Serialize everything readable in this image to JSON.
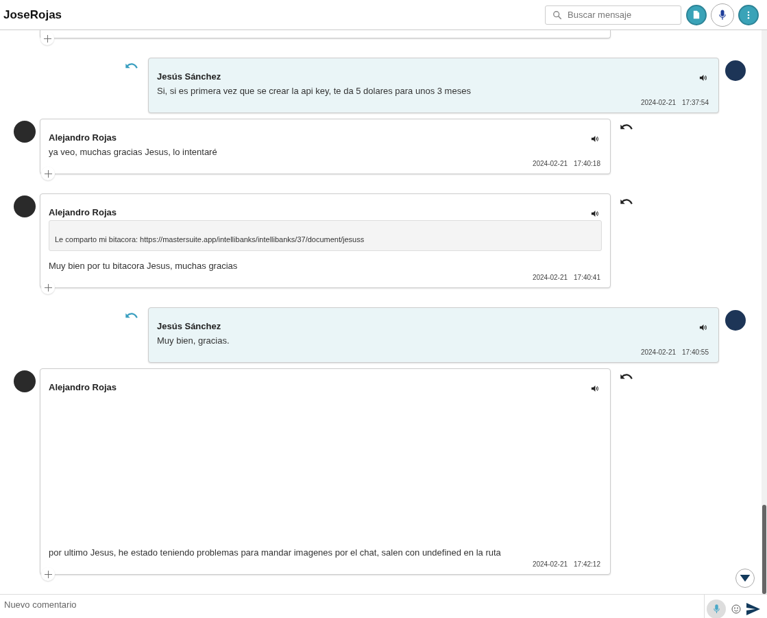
{
  "header": {
    "title": "JoseRojas",
    "search": {
      "placeholder": "Buscar mensaje"
    }
  },
  "messages": [
    {
      "kind": "outgoing",
      "sender": "Jesús Sánchez",
      "text": "Si, si es primera vez que se crear la api key, te da 5 dolares para unos 3 meses",
      "date": "2024-02-21",
      "time": "17:37:54"
    },
    {
      "kind": "incoming",
      "sender": "Alejandro Rojas",
      "text": "ya veo, muchas gracias Jesus, lo intentaré",
      "date": "2024-02-21",
      "time": "17:40:18"
    },
    {
      "kind": "incoming",
      "sender": "Alejandro Rojas",
      "quote": "Le comparto mi bitacora: https://mastersuite.app/intellibanks/intellibanks/37/document/jesuss",
      "text": "Muy bien por tu bitacora Jesus, muchas gracias",
      "date": "2024-02-21",
      "time": "17:40:41"
    },
    {
      "kind": "outgoing",
      "sender": "Jesús Sánchez",
      "text": "Muy bien, gracias.",
      "date": "2024-02-21",
      "time": "17:40:55"
    },
    {
      "kind": "incoming",
      "sender": "Alejandro Rojas",
      "has_attachment": true,
      "text": "por ultimo Jesus, he estado teniendo problemas para mandar imagenes por el chat, salen con undefined en la ruta",
      "date": "2024-02-21",
      "time": "17:42:12"
    }
  ],
  "composer": {
    "placeholder": "Nuevo comentario"
  }
}
